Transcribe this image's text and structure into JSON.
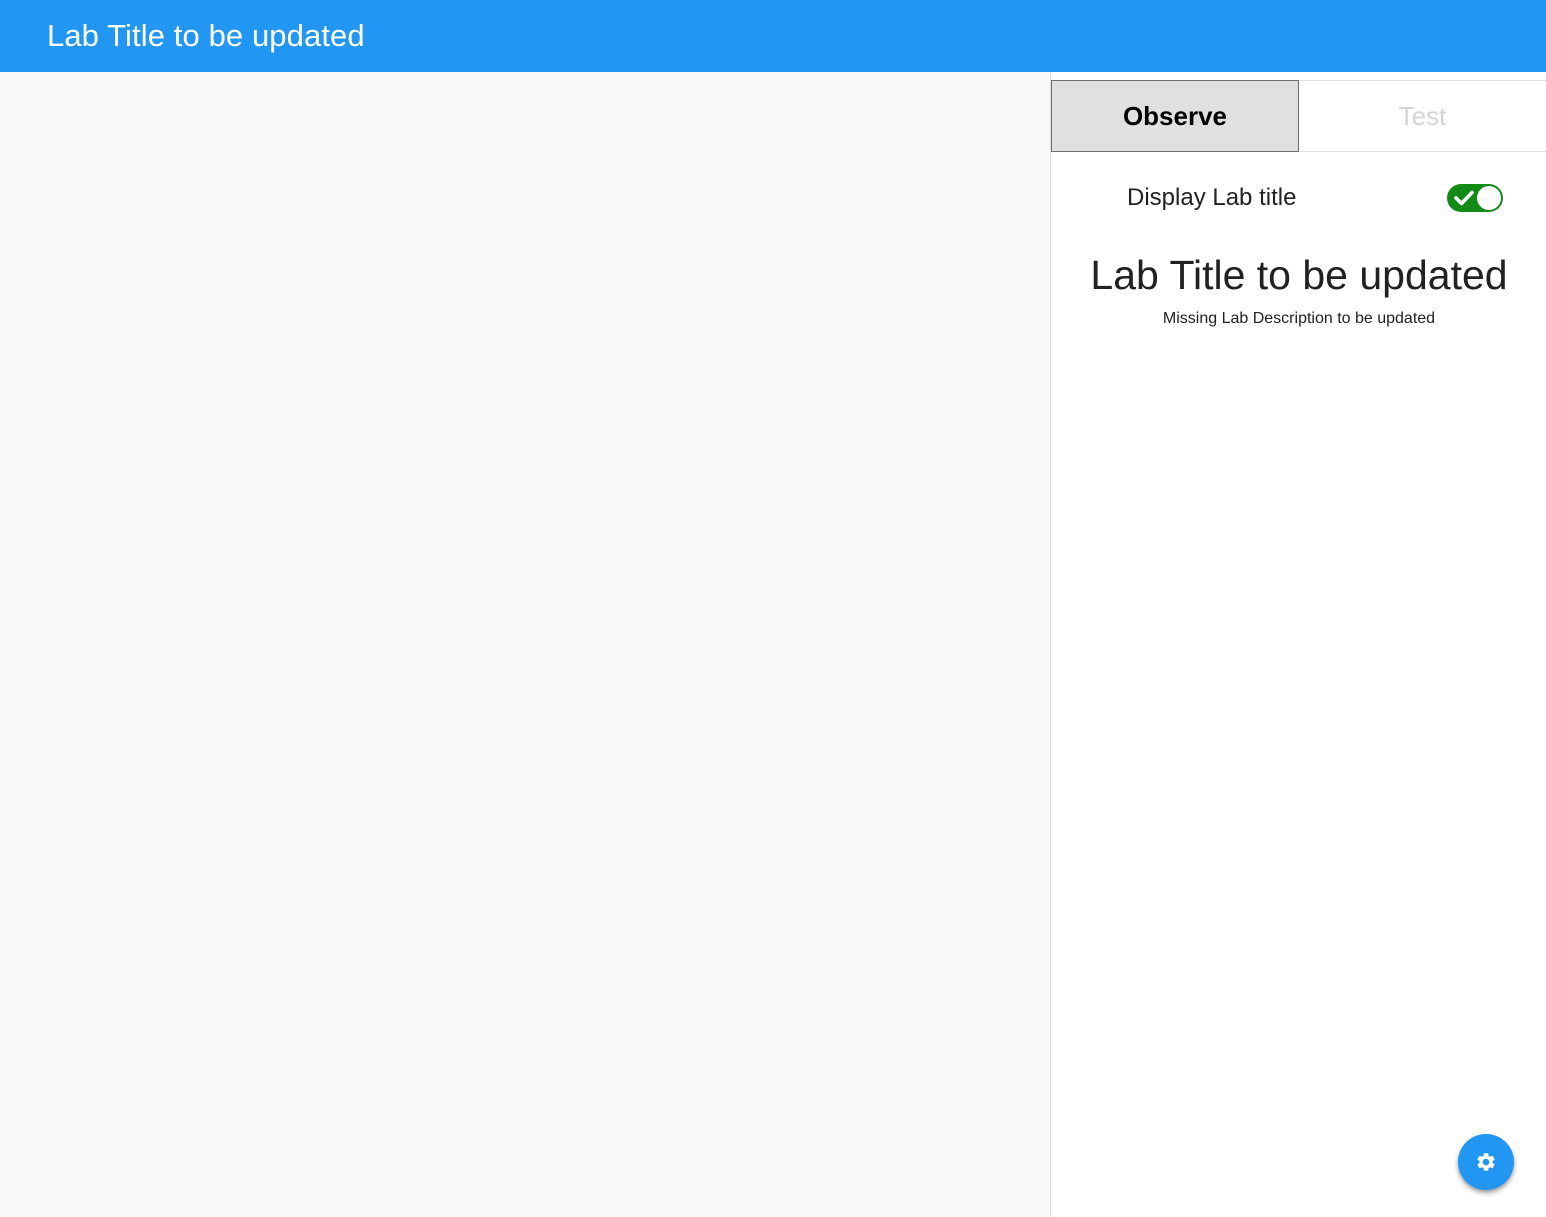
{
  "app_bar": {
    "title": "Lab Title to be updated",
    "background_color": "#2196f3"
  },
  "side_panel": {
    "tabs": [
      {
        "label": "Observe",
        "selected": true
      },
      {
        "label": "Test",
        "selected": false
      }
    ],
    "display_title_toggle": {
      "label": "Display Lab title",
      "checked": true,
      "on_color": "#128a16",
      "icon": "check-icon"
    },
    "lab": {
      "title": "Lab Title to be updated",
      "description": "Missing Lab Description to be updated"
    }
  },
  "fab": {
    "icon": "gear-icon",
    "color": "#2196f3"
  }
}
